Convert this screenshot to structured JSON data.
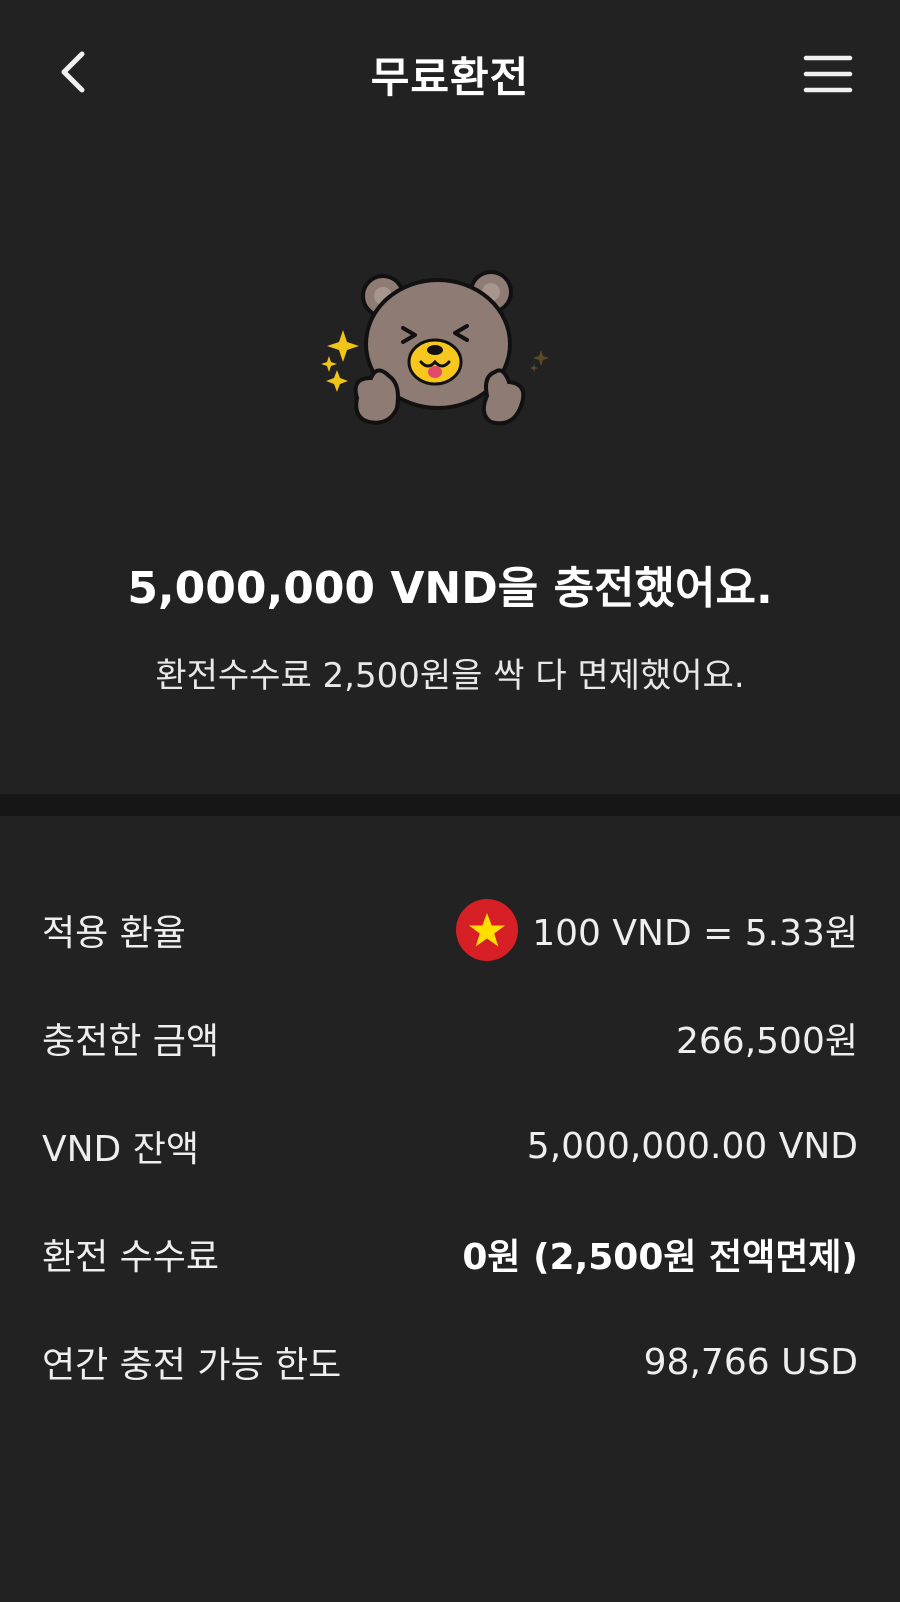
{
  "header": {
    "title": "무료환전",
    "back_icon": "chevron-left-icon",
    "menu_icon": "hamburger-menu-icon"
  },
  "mascot": {
    "icon": "bear-mascot-icon",
    "sparkle_color": "#f0c419"
  },
  "result": {
    "headline": "5,000,000 VND을 충전했어요.",
    "subline": "환전수수료 2,500원을 싹 다 면제했어요."
  },
  "details": {
    "exchange_rate": {
      "label": "적용 환율",
      "value": "100 VND = 5.33원",
      "flag_icon": "vietnam-flag-icon"
    },
    "charged_amount": {
      "label": "충전한 금액",
      "value": "266,500원"
    },
    "vnd_balance": {
      "label": "VND 잔액",
      "value": "5,000,000.00 VND"
    },
    "exchange_fee": {
      "label": "환전 수수료",
      "value": "0원 (2,500원 전액면제)"
    },
    "annual_limit": {
      "label": "연간 충전 가능 한도",
      "value": "98,766 USD"
    }
  },
  "colors": {
    "background": "#222222",
    "divider": "#161616",
    "flag_red": "#d71f26",
    "flag_star": "#ffde00"
  }
}
